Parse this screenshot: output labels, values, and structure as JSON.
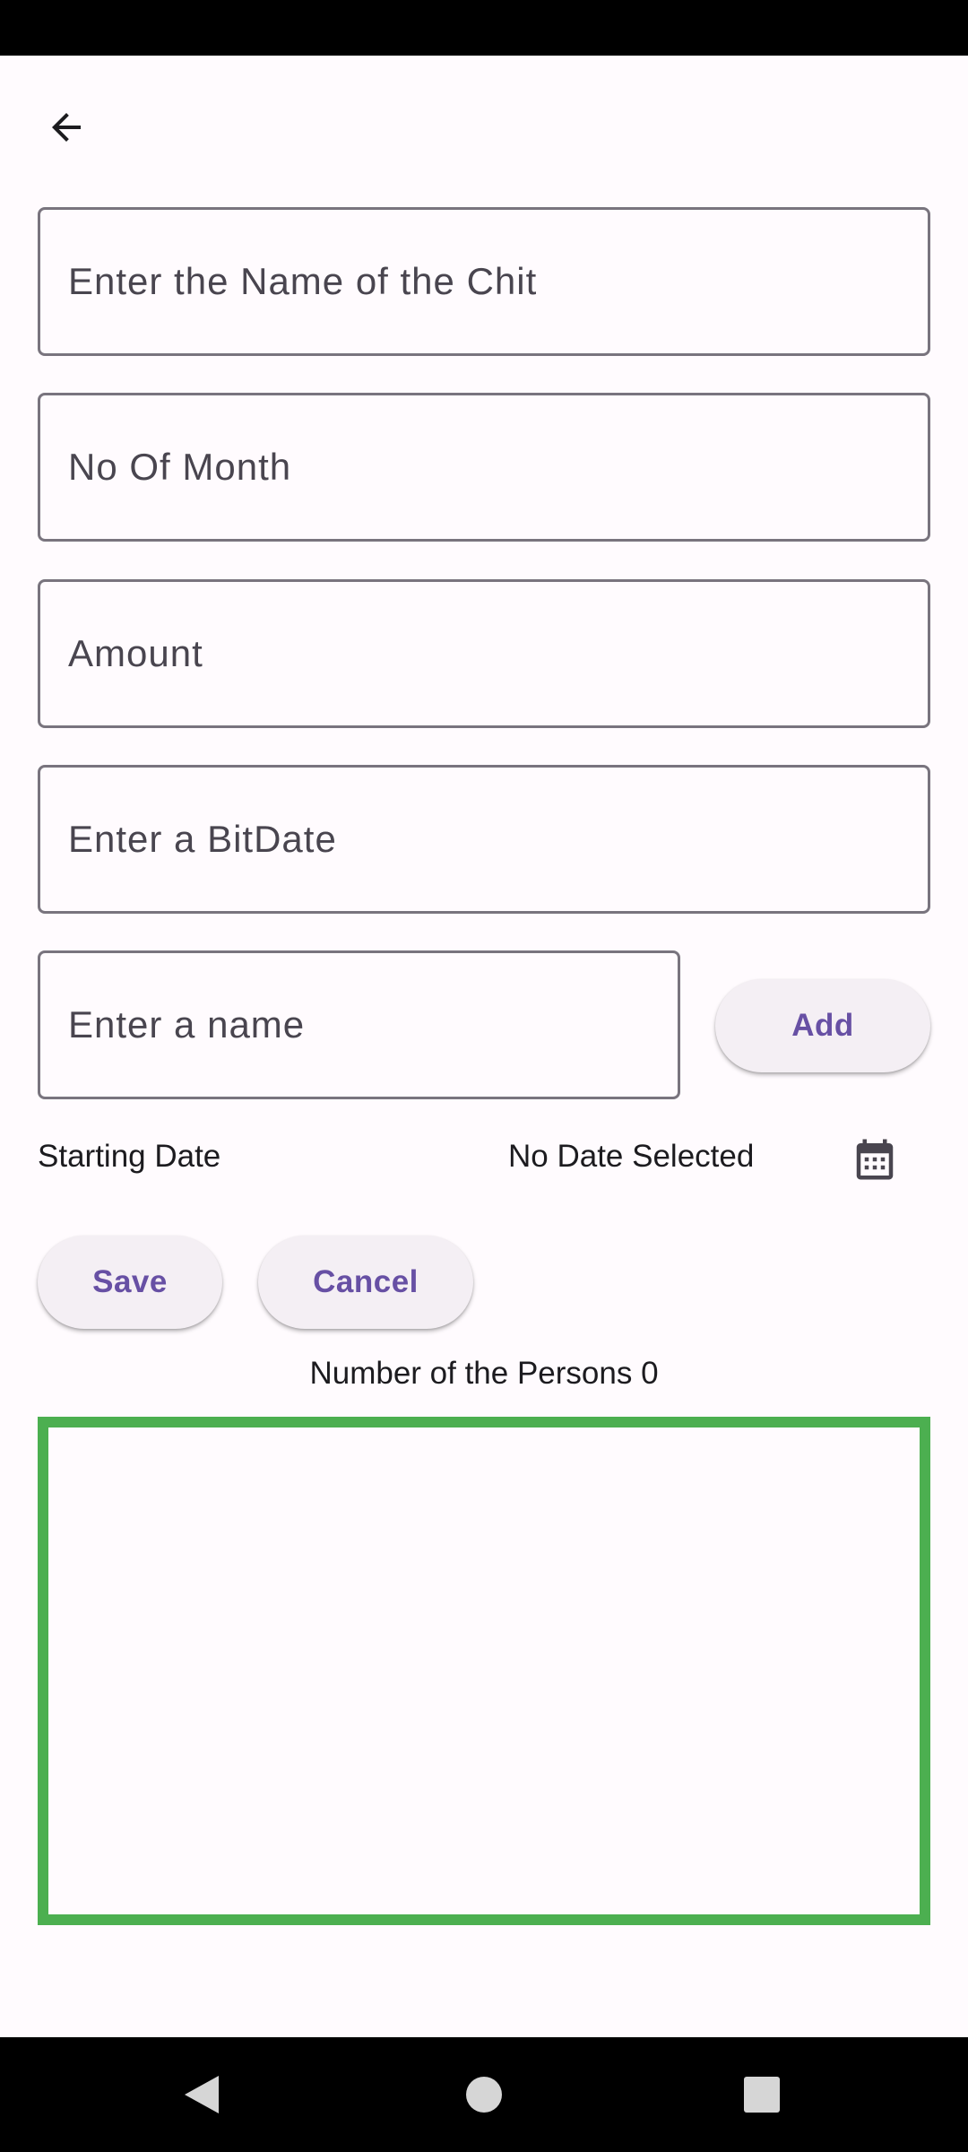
{
  "form": {
    "chit_name": {
      "value": "",
      "placeholder": "Enter the Name of the Chit"
    },
    "months": {
      "value": "",
      "placeholder": "No Of Month"
    },
    "amount": {
      "value": "",
      "placeholder": "Amount"
    },
    "bit_date": {
      "value": "",
      "placeholder": "Enter a BitDate"
    },
    "person_name": {
      "value": "",
      "placeholder": "Enter a name"
    },
    "add_label": "Add"
  },
  "date_row": {
    "label": "Starting Date",
    "value": "No Date Selected",
    "icon": "calendar-icon"
  },
  "actions": {
    "save_label": "Save",
    "cancel_label": "Cancel"
  },
  "persons": {
    "count_text": "Number of the Persons 0",
    "items": []
  },
  "colors": {
    "accent": "#6750a4",
    "list_border": "#4caf50",
    "background": "#fffbfe"
  }
}
